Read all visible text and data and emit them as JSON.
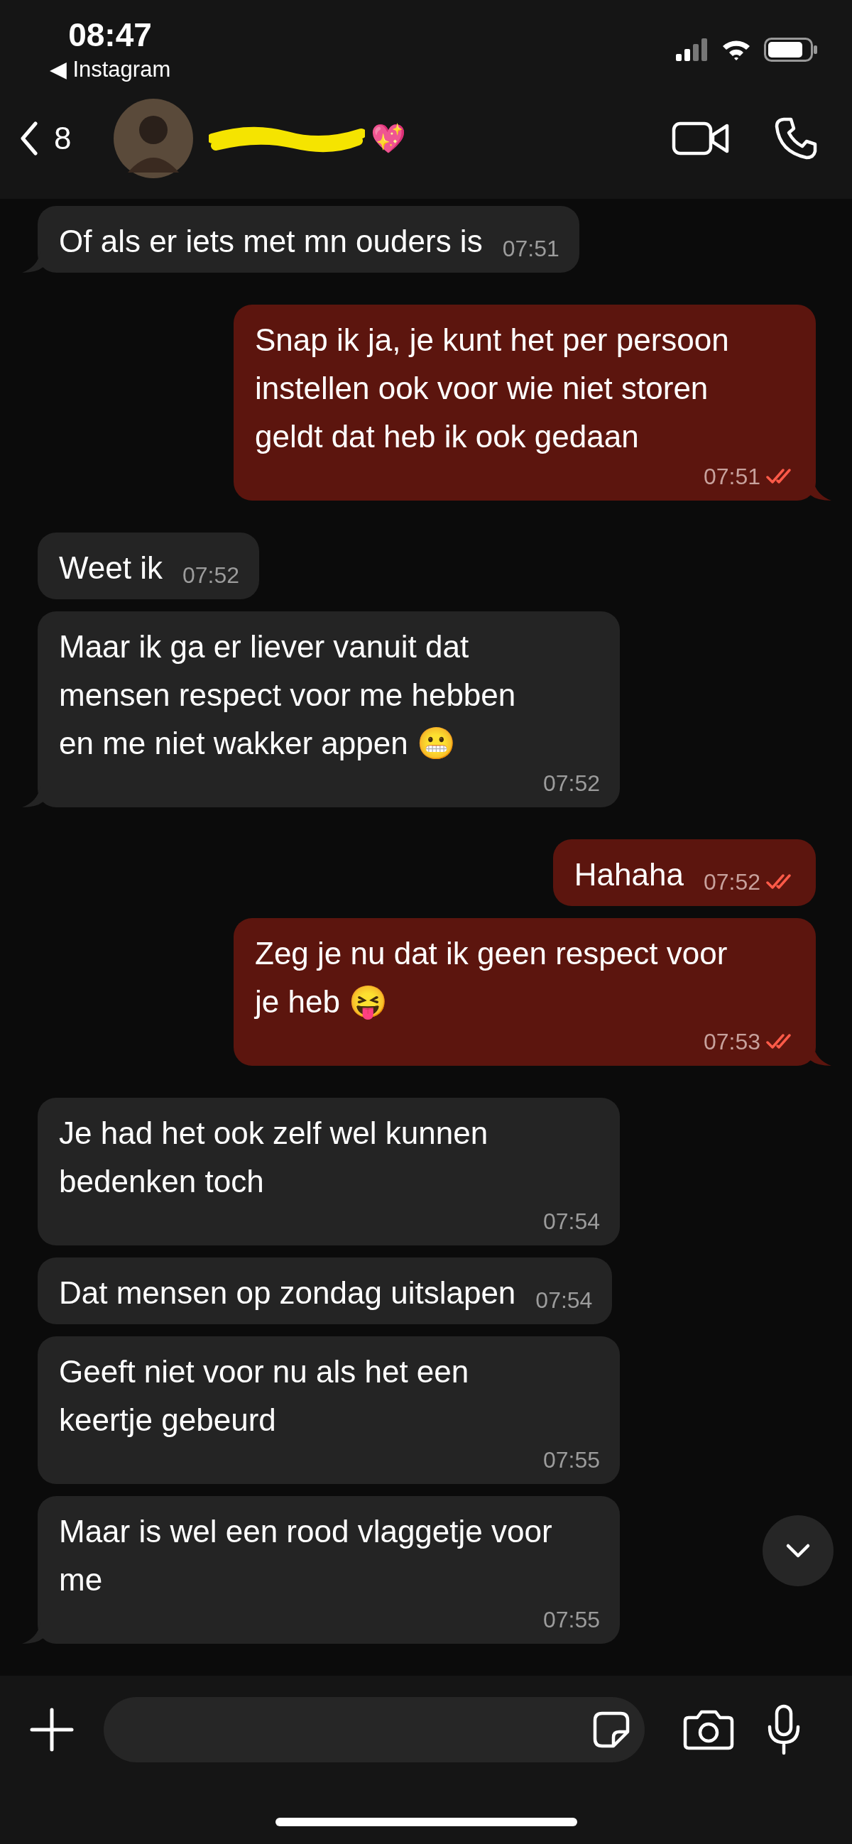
{
  "status_bar": {
    "time": "08:47",
    "back_app": "◀ Instagram"
  },
  "header": {
    "back_count": "8",
    "name_redacted": true,
    "name_tail": "💖"
  },
  "messages": [
    {
      "kind": "incoming",
      "text": "Of als er iets met mn ouders is",
      "time": "07:51",
      "tail": true
    },
    {
      "kind": "outgoing",
      "text": "Snap ik ja, je kunt het per persoon instellen ook voor wie niet storen geldt dat heb ik ook gedaan",
      "time": "07:51",
      "tail": true,
      "read": true
    },
    {
      "kind": "incoming",
      "text": "Weet ik",
      "time": "07:52",
      "tail": false
    },
    {
      "kind": "incoming",
      "text": "Maar ik ga er liever vanuit dat mensen respect voor me hebben en me niet wakker appen 😬",
      "time": "07:52",
      "tail": true
    },
    {
      "kind": "outgoing",
      "text": "Hahaha",
      "time": "07:52",
      "tail": false,
      "read": true
    },
    {
      "kind": "outgoing",
      "text": "Zeg je nu dat ik geen respect voor je heb 😝",
      "time": "07:53",
      "tail": true,
      "read": true
    },
    {
      "kind": "incoming",
      "text": "Je had het ook zelf wel kunnen bedenken toch",
      "time": "07:54",
      "tail": false
    },
    {
      "kind": "incoming",
      "text": "Dat mensen op zondag uitslapen",
      "time": "07:54",
      "tail": false
    },
    {
      "kind": "incoming",
      "text": "Geeft niet voor nu als het een keertje gebeurd",
      "time": "07:55",
      "tail": false
    },
    {
      "kind": "incoming",
      "text": "Maar is wel een rood vlaggetje voor me",
      "time": "07:55",
      "tail": true
    }
  ]
}
